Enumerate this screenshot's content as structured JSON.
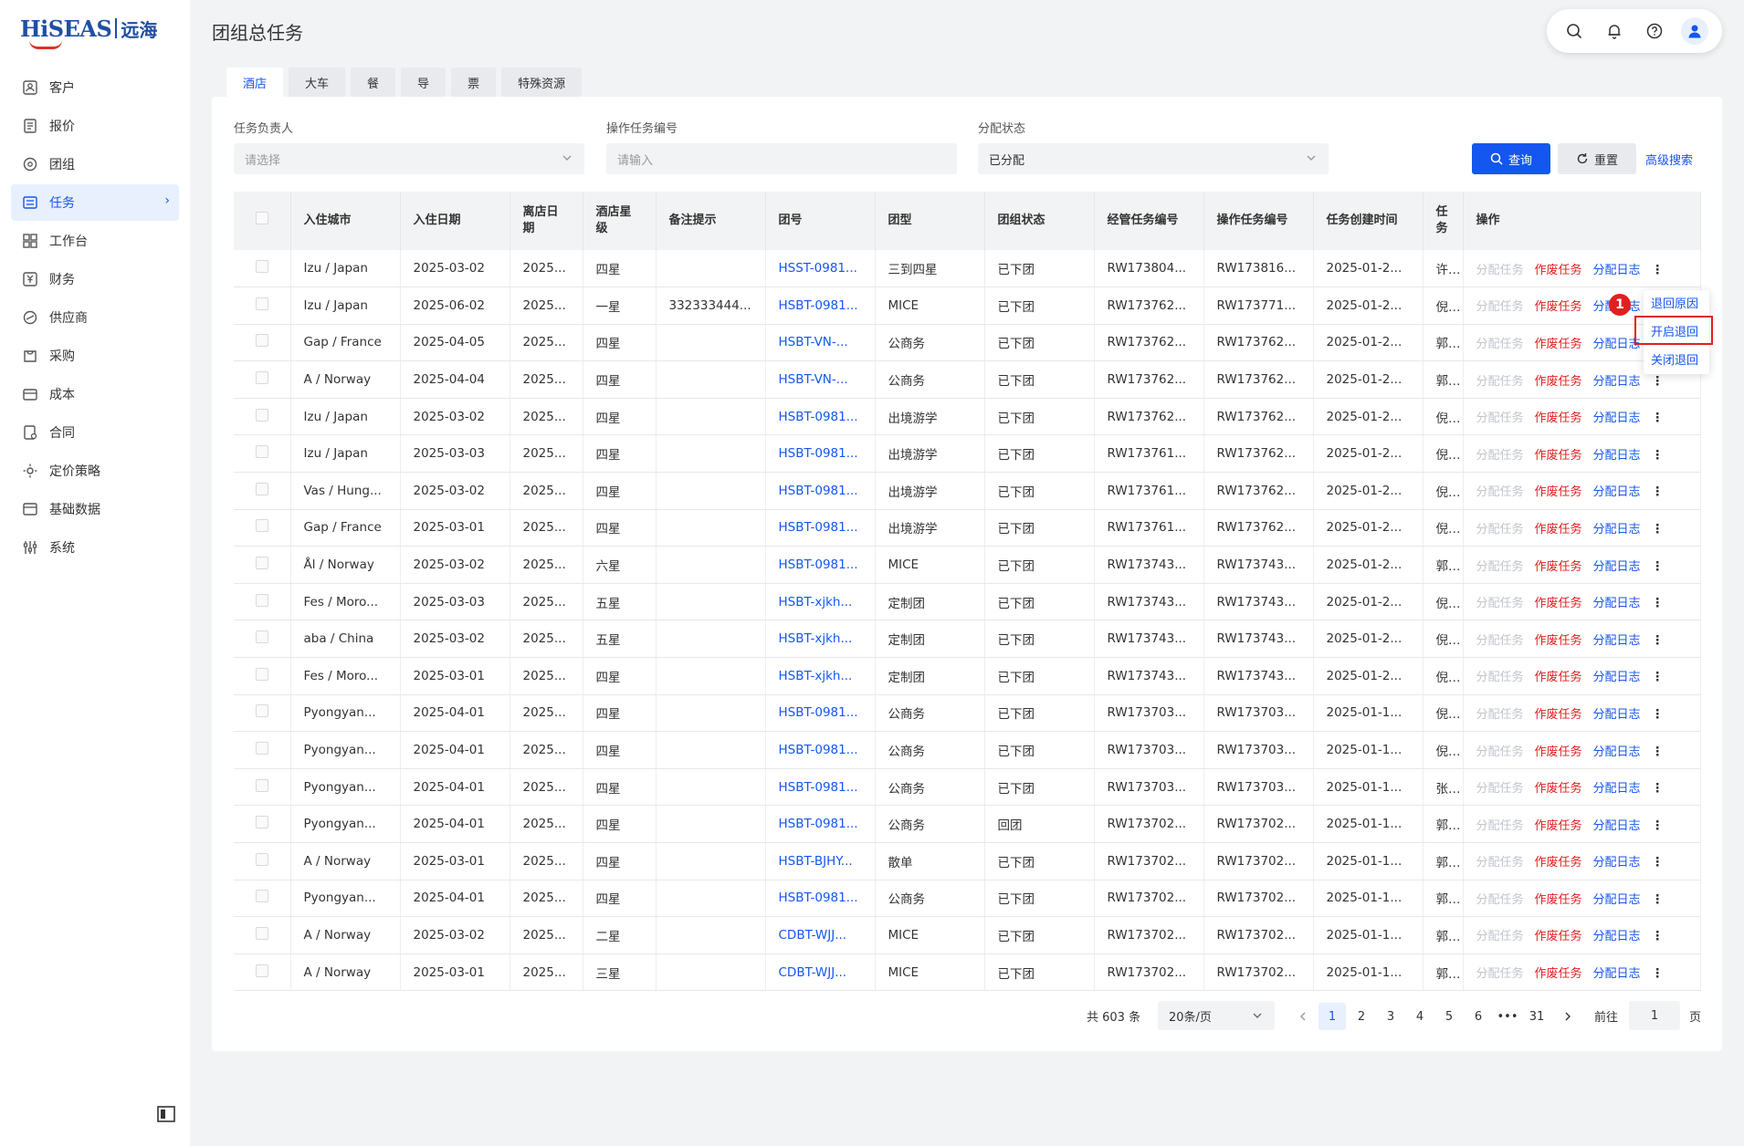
{
  "logo": {
    "brand": "HiSEAS",
    "brand_cn": "远海"
  },
  "sidebar": {
    "items": [
      {
        "label": "客户",
        "icon": "customer-icon"
      },
      {
        "label": "报价",
        "icon": "quote-icon"
      },
      {
        "label": "团组",
        "icon": "group-icon"
      },
      {
        "label": "任务",
        "icon": "task-icon",
        "active": true
      },
      {
        "label": "工作台",
        "icon": "workbench-icon"
      },
      {
        "label": "财务",
        "icon": "finance-icon"
      },
      {
        "label": "供应商",
        "icon": "supplier-icon"
      },
      {
        "label": "采购",
        "icon": "purchase-icon"
      },
      {
        "label": "成本",
        "icon": "cost-icon"
      },
      {
        "label": "合同",
        "icon": "contract-icon"
      },
      {
        "label": "定价策略",
        "icon": "pricing-icon"
      },
      {
        "label": "基础数据",
        "icon": "database-icon"
      },
      {
        "label": "系统",
        "icon": "system-icon"
      }
    ]
  },
  "page": {
    "title": "团组总任务"
  },
  "tabs": [
    "酒店",
    "大车",
    "餐",
    "导",
    "票",
    "特殊资源"
  ],
  "filters": {
    "owner": {
      "label": "任务负责人",
      "placeholder": "请选择"
    },
    "op_task_no": {
      "label": "操作任务编号",
      "placeholder": "请输入"
    },
    "status": {
      "label": "分配状态",
      "value": "已分配"
    },
    "query_label": "查询",
    "reset_label": "重置",
    "advanced_label": "高级搜索"
  },
  "table": {
    "headers": [
      "入住城市",
      "入住日期",
      "离店日期",
      "酒店星级",
      "备注提示",
      "团号",
      "团型",
      "团组状态",
      "经管任务编号",
      "操作任务编号",
      "任务创建时间",
      "任务",
      "操作"
    ],
    "ops": {
      "assign": "分配任务",
      "void": "作废任务",
      "log": "分配日志"
    },
    "rows": [
      [
        "Izu / Japan",
        "2025-03-02",
        "2025...",
        "四星",
        "",
        "HSST-0981...",
        "三到四星",
        "已下团",
        "RW173804...",
        "RW173816...",
        "2025-01-2...",
        "许丹"
      ],
      [
        "Izu / Japan",
        "2025-06-02",
        "2025...",
        "一星",
        "332333444...",
        "HSBT-0981...",
        "MICE",
        "已下团",
        "RW173762...",
        "RW173771...",
        "2025-01-2...",
        "倪超"
      ],
      [
        "Gap / France",
        "2025-04-05",
        "2025...",
        "四星",
        "",
        "HSBT-VN-...",
        "公商务",
        "已下团",
        "RW173762...",
        "RW173762...",
        "2025-01-2...",
        "郭旭"
      ],
      [
        "A / Norway",
        "2025-04-04",
        "2025...",
        "四星",
        "",
        "HSBT-VN-...",
        "公商务",
        "已下团",
        "RW173762...",
        "RW173762...",
        "2025-01-2...",
        "郭旭"
      ],
      [
        "Izu / Japan",
        "2025-03-02",
        "2025...",
        "四星",
        "",
        "HSBT-0981...",
        "出境游学",
        "已下团",
        "RW173762...",
        "RW173762...",
        "2025-01-2...",
        "倪超"
      ],
      [
        "Izu / Japan",
        "2025-03-03",
        "2025...",
        "四星",
        "",
        "HSBT-0981...",
        "出境游学",
        "已下团",
        "RW173761...",
        "RW173762...",
        "2025-01-2...",
        "倪超"
      ],
      [
        "Vas / Hung...",
        "2025-03-02",
        "2025...",
        "四星",
        "",
        "HSBT-0981...",
        "出境游学",
        "已下团",
        "RW173761...",
        "RW173762...",
        "2025-01-2...",
        "倪超"
      ],
      [
        "Gap / France",
        "2025-03-01",
        "2025...",
        "四星",
        "",
        "HSBT-0981...",
        "出境游学",
        "已下团",
        "RW173761...",
        "RW173762...",
        "2025-01-2...",
        "倪超"
      ],
      [
        "Ål / Norway",
        "2025-03-02",
        "2025...",
        "六星",
        "",
        "HSBT-0981...",
        "MICE",
        "已下团",
        "RW173743...",
        "RW173743...",
        "2025-01-2...",
        "郭旭"
      ],
      [
        "Fes / Moro...",
        "2025-03-03",
        "2025...",
        "五星",
        "",
        "HSBT-xjkh...",
        "定制团",
        "已下团",
        "RW173743...",
        "RW173743...",
        "2025-01-2...",
        "倪超"
      ],
      [
        "aba / China",
        "2025-03-02",
        "2025...",
        "五星",
        "",
        "HSBT-xjkh...",
        "定制团",
        "已下团",
        "RW173743...",
        "RW173743...",
        "2025-01-2...",
        "倪超"
      ],
      [
        "Fes / Moro...",
        "2025-03-01",
        "2025...",
        "四星",
        "",
        "HSBT-xjkh...",
        "定制团",
        "已下团",
        "RW173743...",
        "RW173743...",
        "2025-01-2...",
        "倪超"
      ],
      [
        "Pyongyan...",
        "2025-04-01",
        "2025...",
        "四星",
        "",
        "HSBT-0981...",
        "公商务",
        "已下团",
        "RW173703...",
        "RW173703...",
        "2025-01-1...",
        "倪超"
      ],
      [
        "Pyongyan...",
        "2025-04-01",
        "2025...",
        "四星",
        "",
        "HSBT-0981...",
        "公商务",
        "已下团",
        "RW173703...",
        "RW173703...",
        "2025-01-1...",
        "倪超"
      ],
      [
        "Pyongyan...",
        "2025-04-01",
        "2025...",
        "四星",
        "",
        "HSBT-0981...",
        "公商务",
        "已下团",
        "RW173703...",
        "RW173703...",
        "2025-01-1...",
        "张强"
      ],
      [
        "Pyongyan...",
        "2025-04-01",
        "2025...",
        "四星",
        "",
        "HSBT-0981...",
        "公商务",
        "回团",
        "RW173702...",
        "RW173702...",
        "2025-01-1...",
        "郭旭"
      ],
      [
        "A / Norway",
        "2025-03-01",
        "2025...",
        "四星",
        "",
        "HSBT-BJHY...",
        "散单",
        "已下团",
        "RW173702...",
        "RW173702...",
        "2025-01-1...",
        "郭旭"
      ],
      [
        "Pyongyan...",
        "2025-04-01",
        "2025...",
        "四星",
        "",
        "HSBT-0981...",
        "公商务",
        "已下团",
        "RW173702...",
        "RW173702...",
        "2025-01-1...",
        "郭旭"
      ],
      [
        "A / Norway",
        "2025-03-02",
        "2025...",
        "二星",
        "",
        "CDBT-WJJ...",
        "MICE",
        "已下团",
        "RW173702...",
        "RW173702...",
        "2025-01-1...",
        "郭旭"
      ],
      [
        "A / Norway",
        "2025-03-01",
        "2025...",
        "三星",
        "",
        "CDBT-WJJ...",
        "MICE",
        "已下团",
        "RW173702...",
        "RW173702...",
        "2025-01-1...",
        "郭旭"
      ]
    ]
  },
  "dropdown": {
    "items": [
      "退回原因",
      "开启退回",
      "关闭退回"
    ],
    "badge": "1"
  },
  "pagination": {
    "total": "共 603 条",
    "page_size": "20条/页",
    "pages": [
      "1",
      "2",
      "3",
      "4",
      "5",
      "6",
      "31"
    ],
    "ellipsis": "•••",
    "current": "1",
    "goto_prefix": "前往",
    "goto_value": "1",
    "goto_suffix": "页"
  },
  "colors": {
    "accent": "#1456f0",
    "danger": "#e02020"
  }
}
